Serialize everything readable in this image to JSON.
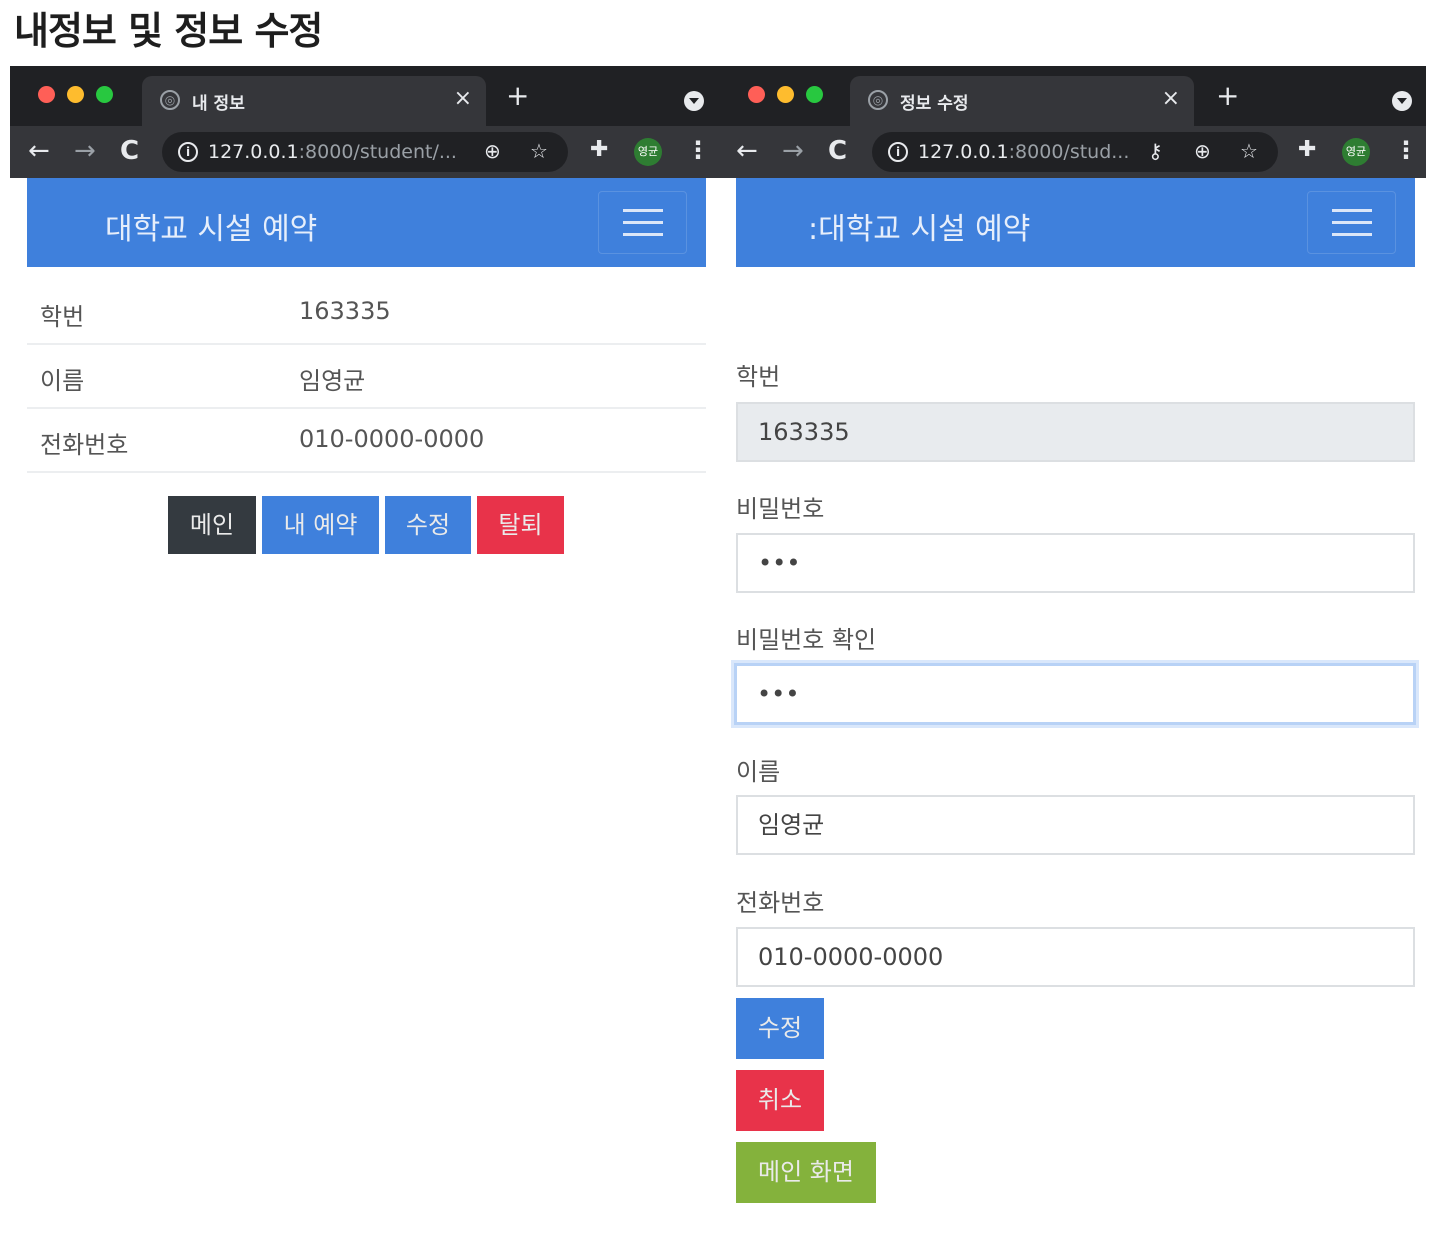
{
  "heading": "내정보 및 정보 수정",
  "colors": {
    "navbar": "#3f80dc",
    "btn_dark": "#343a40",
    "btn_primary": "#3f80dc",
    "btn_danger": "#e8334a",
    "btn_success": "#84b23c"
  },
  "left_window": {
    "tab_title": "내 정보",
    "url_host": "127.0.0.1",
    "url_rest": ":8000/student/...",
    "profile_badge": "영균",
    "brand": "대학교 시설 예약",
    "rows": [
      {
        "label": "학번",
        "value": "163335"
      },
      {
        "label": "이름",
        "value": "임영균"
      },
      {
        "label": "전화번호",
        "value": "010-0000-0000"
      }
    ],
    "buttons": {
      "main": "메인",
      "my_reservation": "내 예약",
      "edit": "수정",
      "withdraw": "탈퇴"
    }
  },
  "right_window": {
    "tab_title": "정보 수정",
    "url_host": "127.0.0.1",
    "url_rest": ":8000/stud...",
    "profile_badge": "영균",
    "brand": ":대학교 시설 예약",
    "form": {
      "student_id_label": "학번",
      "student_id_value": "163335",
      "password_label": "비밀번호",
      "password_value": "•••",
      "password_confirm_label": "비밀번호 확인",
      "password_confirm_value": "•••",
      "name_label": "이름",
      "name_value": "임영균",
      "phone_label": "전화번호",
      "phone_value": "010-0000-0000"
    },
    "buttons": {
      "submit": "수정",
      "cancel": "취소",
      "home": "메인 화면"
    }
  },
  "icons": {
    "close": "×",
    "new_tab": "+",
    "back": "←",
    "forward": "→",
    "reload": "C",
    "info": "i",
    "zoom": "⊕",
    "star": "☆",
    "key": "⚷",
    "extensions": "✚",
    "menu": "⋮"
  }
}
